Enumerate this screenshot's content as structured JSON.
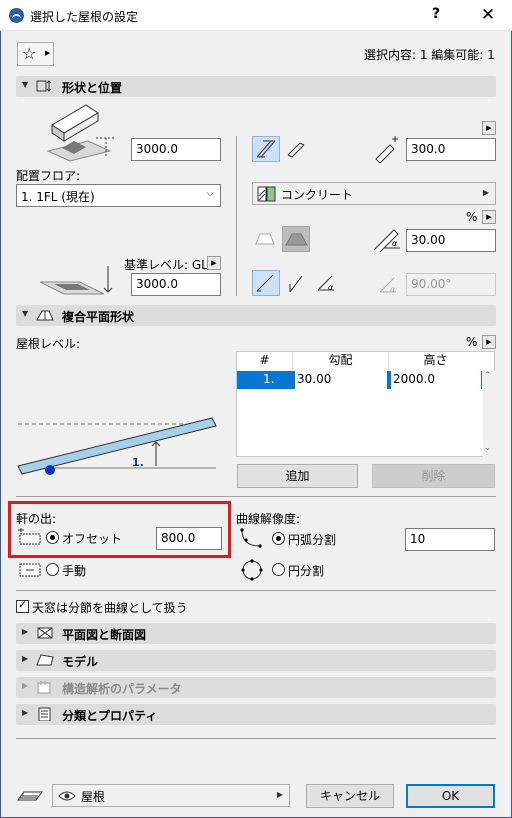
{
  "window": {
    "title": "選択した屋根の設定",
    "help": "?",
    "close": "✕"
  },
  "header": {
    "selection_info": "選択内容: 1 編集可能: 1"
  },
  "sections": {
    "shape": "形状と位置",
    "multiplane": "複合平面形状",
    "floor_plan": "平面図と断面図",
    "model": "モデル",
    "structural": "構造解析のパラメータ",
    "classification": "分類とプロパティ"
  },
  "shape_position": {
    "top_offset": "3000.0",
    "floor_label": "配置フロア:",
    "floor_value": "1. 1FL (現在)",
    "ref_level_label": "基準レベル: GL",
    "bottom_offset": "3000.0",
    "thickness": "300.0",
    "material": "コンクリート",
    "percent": "%",
    "angle": "30.00",
    "edge_angle": "90.00°"
  },
  "multiplane": {
    "level_label": "屋根レベル:",
    "percent": "%",
    "diagram_label": "1.",
    "table": {
      "headers": [
        "#",
        "勾配",
        "高さ"
      ],
      "rows": [
        {
          "num": "1.",
          "slope": "30.00",
          "height": "2000.0"
        }
      ]
    },
    "add_button": "追加",
    "delete_button": "削除"
  },
  "eaves": {
    "label": "軒の出:",
    "offset_label": "オフセット",
    "offset_value": "800.0",
    "manual_label": "手動"
  },
  "curve": {
    "label": "曲線解像度:",
    "arc_label": "円弧分割",
    "arc_value": "10",
    "circle_label": "円分割"
  },
  "options": {
    "skylight_label": "天窓は分節を曲線として扱う"
  },
  "footer": {
    "layer_value": "屋根",
    "cancel_button": "キャンセル",
    "ok_button": "OK"
  }
}
